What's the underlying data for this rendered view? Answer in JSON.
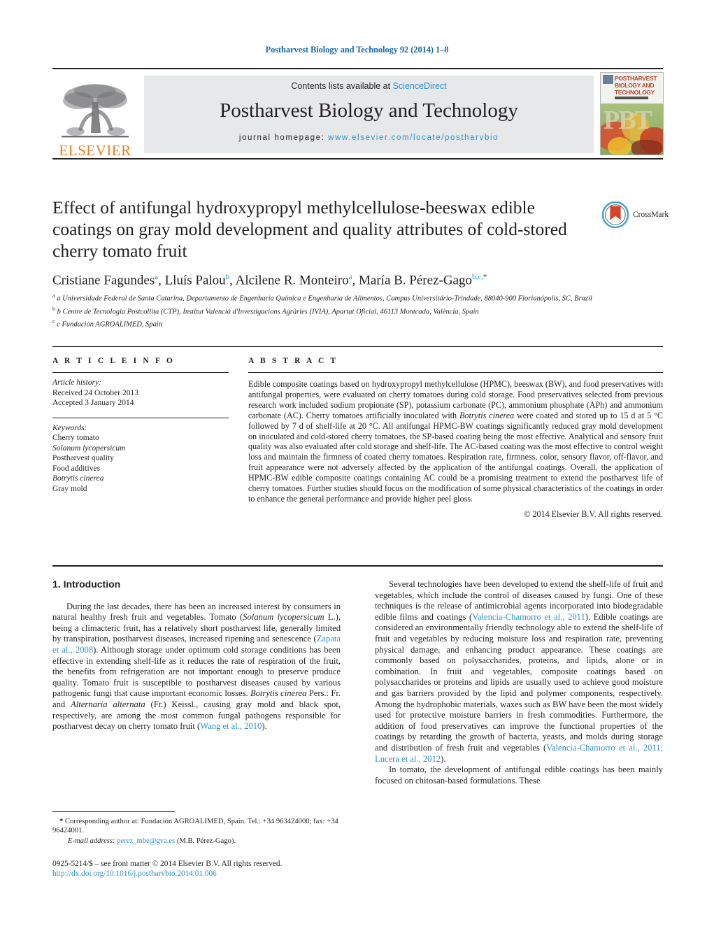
{
  "running_head": "Postharvest Biology and Technology 92 (2014) 1–8",
  "masthead": {
    "publisher_name": "ELSEVIER",
    "contents_prefix": "Contents lists available at ",
    "sciencedirect": "ScienceDirect",
    "journal_title": "Postharvest Biology and Technology",
    "homepage_prefix": "journal homepage: ",
    "homepage_url": "www.elsevier.com/locate/postharvbio",
    "cover": {
      "title_line1": "POSTHARVEST",
      "title_line2": "BIOLOGY AND",
      "title_line3": "TECHNOLOGY",
      "monogram": "PBT"
    }
  },
  "crossmark": {
    "label": "CrossMark"
  },
  "article": {
    "title": "Effect of antifungal hydroxypropyl methylcellulose-beeswax edible coatings on gray mold development and quality attributes of cold-stored cherry tomato fruit",
    "authors_html": "Cristiane Fagundes<sup>a</sup>, Lluís Palou<sup>b</sup>, Alcilene R. Monteiro<sup>a</sup>, María B. Pérez-Gago<sup>b,c,</sup><sup class=\"star\">*</sup>",
    "affiliations": [
      "a Universidade Federal de Santa Catarina, Departamento de Engenharia Química e Engenharia de Alimentos, Campus Universitário-Trindade, 88040-900 Florianópolis, SC, Brazil",
      "b Centre de Tecnologia Postcollita (CTP), Institut Valencià d'Investigacions Agràries (IVIA), Apartat Oficial, 46113 Montcada, València, Spain",
      "c Fundación AGROALIMED, Spain"
    ]
  },
  "article_info": {
    "heading": "A R T I C L E   I N F O",
    "history_label": "Article history:",
    "received": "Received 24 October 2013",
    "accepted": "Accepted 3 January 2014",
    "keywords_label": "Keywords:",
    "keywords": [
      "Cherry tomato",
      "Solanum lycopersicum",
      "Postharvest quality",
      "Food additives",
      "Botrytis cinerea",
      "Gray mold"
    ]
  },
  "abstract": {
    "heading": "A B S T R A C T",
    "text_html": "Edible composite coatings based on hydroxypropyl methylcellulose (HPMC), beeswax (BW), and food preservatives with antifungal properties, were evaluated on cherry tomatoes during cold storage. Food preservatives selected from previous research work included sodium propionate (SP), potassium carbonate (PC), ammonium phosphate (APh) and ammonium carbonate (AC). Cherry tomatoes artificially inoculated with <i>Botrytis cinerea</i> were coated and stored up to 15 d at 5 &deg;C followed by 7 d of shelf-life at 20 &deg;C. All antifungal HPMC-BW coatings significantly reduced gray mold development on inoculated and cold-stored cherry tomatoes, the SP-based coating being the most effective. Analytical and sensory fruit quality was also evaluated after cold storage and shelf-life. The AC-based coating was the most effective to control weight loss and maintain the firmness of coated cherry tomatoes. Respiration rate, firmness, color, sensory flavor, off-flavor, and fruit appearance were not adversely affected by the application of the antifungal coatings. Overall, the application of HPMC-BW edible composite coatings containing AC could be a promising treatment to extend the postharvest life of cherry tomatoes. Further studies should focus on the modification of some physical characteristics of the coatings in order to enhance the general performance and provide higher peel gloss.",
    "copyright": "© 2014 Elsevier B.V. All rights reserved."
  },
  "introduction": {
    "heading": "1.  Introduction",
    "left_paragraphs_html": [
      "During the last decades, there has been an increased interest by consumers in natural healthy fresh fruit and vegetables. Tomato (<i>Solanum lycopersicum</i> L.), being a climacteric fruit, has a relatively short postharvest life, generally limited by transpiration, postharvest diseases, increased ripening and senescence (<a class=\"ref\" href=\"#\">Zapata et al., 2008</a>). Although storage under optimum cold storage conditions has been effective in extending shelf-life as it reduces the rate of respiration of the fruit, the benefits from refrigeration are not important enough to preserve produce quality. Tomato fruit is susceptible to postharvest diseases caused by various pathogenic fungi that cause important economic losses. <i>Botrytis cinerea</i> Pers.: Fr. and <i>Alternaria alternata</i> (Fr.) Keissl., causing gray mold and black spot, respectively, are among the most common fungal pathogens responsible for postharvest decay on cherry tomato fruit (<a class=\"ref\" href=\"#\">Wang et al., 2010</a>)."
    ],
    "right_paragraphs_html": [
      "Several technologies have been developed to extend the shelf-life of fruit and vegetables, which include the control of diseases caused by fungi. One of these techniques is the release of antimicrobial agents incorporated into biodegradable edible films and coatings (<a class=\"ref\" href=\"#\">Valencia-Chamorro et al., 2011</a>). Edible coatings are considered an environmentally friendly technology able to extend the shelf-life of fruit and vegetables by reducing moisture loss and respiration rate, preventing physical damage, and enhancing product appearance. These coatings are commonly based on polysaccharides, proteins, and lipids, alone or in combination. In fruit and vegetables, composite coatings based on polysaccharides or proteins and lipids are usually used to achieve good moisture and gas barriers provided by the lipid and polymer components, respectively. Among the hydrophobic materials, waxes such as BW have been the most widely used for protective moisture barriers in fresh commodities. Furthermore, the addition of food preservatives can improve the functional properties of the coatings by retarding the growth of bacteria, yeasts, and molds during storage and distribution of fresh fruit and vegetables (<a class=\"ref\" href=\"#\">Valencia-Chamorro et al., 2011; Lucera et al., 2012</a>).",
      "In tomato, the development of antifungal edible coatings has been mainly focused on chitosan-based formulations. These"
    ]
  },
  "footnotes": {
    "corresponding_html": "<b>*</b> Corresponding author at: Fundación AGROALIMED, Spain. Tel.: +34 963424000; fax: +34 96424001.",
    "email_html": "<i>E-mail address:</i> <a href=\"#\">perez_mbe@gva.es</a> (M.B. Pérez-Gago)."
  },
  "issn_block": {
    "line1": "0925-5214/$ – see front matter © 2014 Elsevier B.V. All rights reserved.",
    "doi": "http://dx.doi.org/10.1016/j.postharvbio.2014.01.006"
  },
  "colors": {
    "link_blue": "#2b8fcd",
    "runhead_blue": "#1b6ca8",
    "elsevier_orange": "#ef7c20",
    "band_gray": "#e7e8ea",
    "text": "#231f20"
  }
}
